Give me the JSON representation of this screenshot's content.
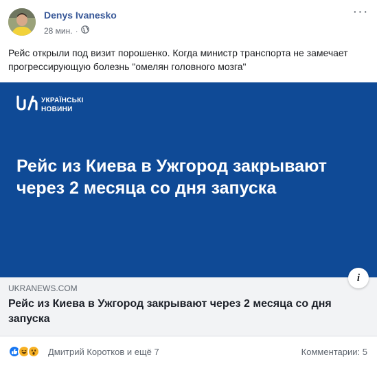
{
  "post": {
    "author": "Denys Ivanesko",
    "time": "28 мин.",
    "separator": "·",
    "menu_label": "···",
    "text": "Рейс открыли под визит порошенко. Когда министр транспорта не замечает прогрессирующую болезнь \"омелян головного мозга\""
  },
  "banner": {
    "logo_line1": "УКРАЇНСЬКІ",
    "logo_line2": "НОВИНИ",
    "headline": "Рейс из Киева в Ужгород закрывают через 2 месяца со дня запуска",
    "background_color": "#0f4a96"
  },
  "link": {
    "domain": "UKRANEWS.COM",
    "title": "Рейс из Киева в Ужгород закрывают через 2 месяца со дня запуска",
    "info_label": "i"
  },
  "footer": {
    "reaction_icons": [
      "like-icon",
      "haha-icon",
      "wow-icon"
    ],
    "reaction_names": "Дмитрий Коротков и ещё 7",
    "comments": "Комментарии: 5"
  },
  "colors": {
    "author": "#385898",
    "like": "#1877f2",
    "emoji": "#f7b125"
  }
}
